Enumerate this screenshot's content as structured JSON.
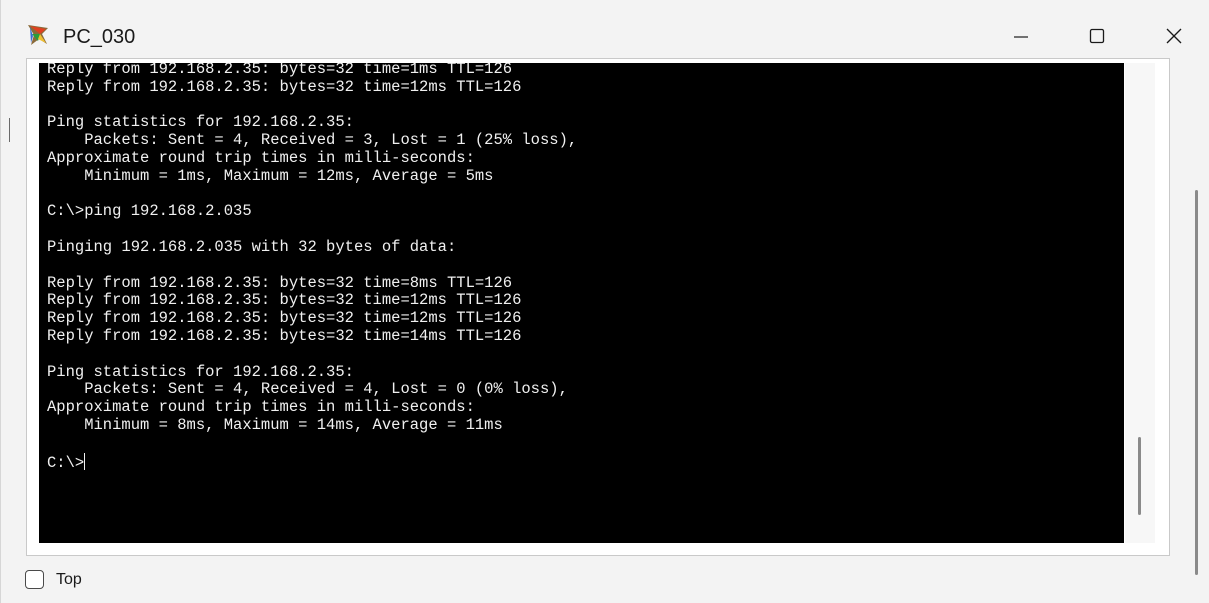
{
  "window": {
    "title": "PC_030",
    "controls": {
      "minimize": "—",
      "maximize": "☐",
      "close": "✕"
    }
  },
  "terminal": {
    "lines": [
      "Reply from 192.168.2.35: bytes=32 time=1ms TTL=126",
      "Reply from 192.168.2.35: bytes=32 time=12ms TTL=126",
      "",
      "Ping statistics for 192.168.2.35:",
      "    Packets: Sent = 4, Received = 3, Lost = 1 (25% loss),",
      "Approximate round trip times in milli-seconds:",
      "    Minimum = 1ms, Maximum = 12ms, Average = 5ms",
      "",
      "C:\\>ping 192.168.2.035",
      "",
      "Pinging 192.168.2.035 with 32 bytes of data:",
      "",
      "Reply from 192.168.2.35: bytes=32 time=8ms TTL=126",
      "Reply from 192.168.2.35: bytes=32 time=12ms TTL=126",
      "Reply from 192.168.2.35: bytes=32 time=12ms TTL=126",
      "Reply from 192.168.2.35: bytes=32 time=14ms TTL=126",
      "",
      "Ping statistics for 192.168.2.35:",
      "    Packets: Sent = 4, Received = 4, Lost = 0 (0% loss),",
      "Approximate round trip times in milli-seconds:",
      "    Minimum = 8ms, Maximum = 14ms, Average = 11ms",
      ""
    ],
    "prompt": "C:\\>"
  },
  "footer": {
    "top_checkbox_label": "Top",
    "top_checked": false
  },
  "colors": {
    "terminal_bg": "#000000",
    "terminal_fg": "#f0f0f0",
    "window_bg": "#f3f3f3"
  },
  "icons": {
    "app": "packet-tracer-pc-icon",
    "minimize": "minimize-icon",
    "maximize": "maximize-icon",
    "close": "close-icon"
  }
}
